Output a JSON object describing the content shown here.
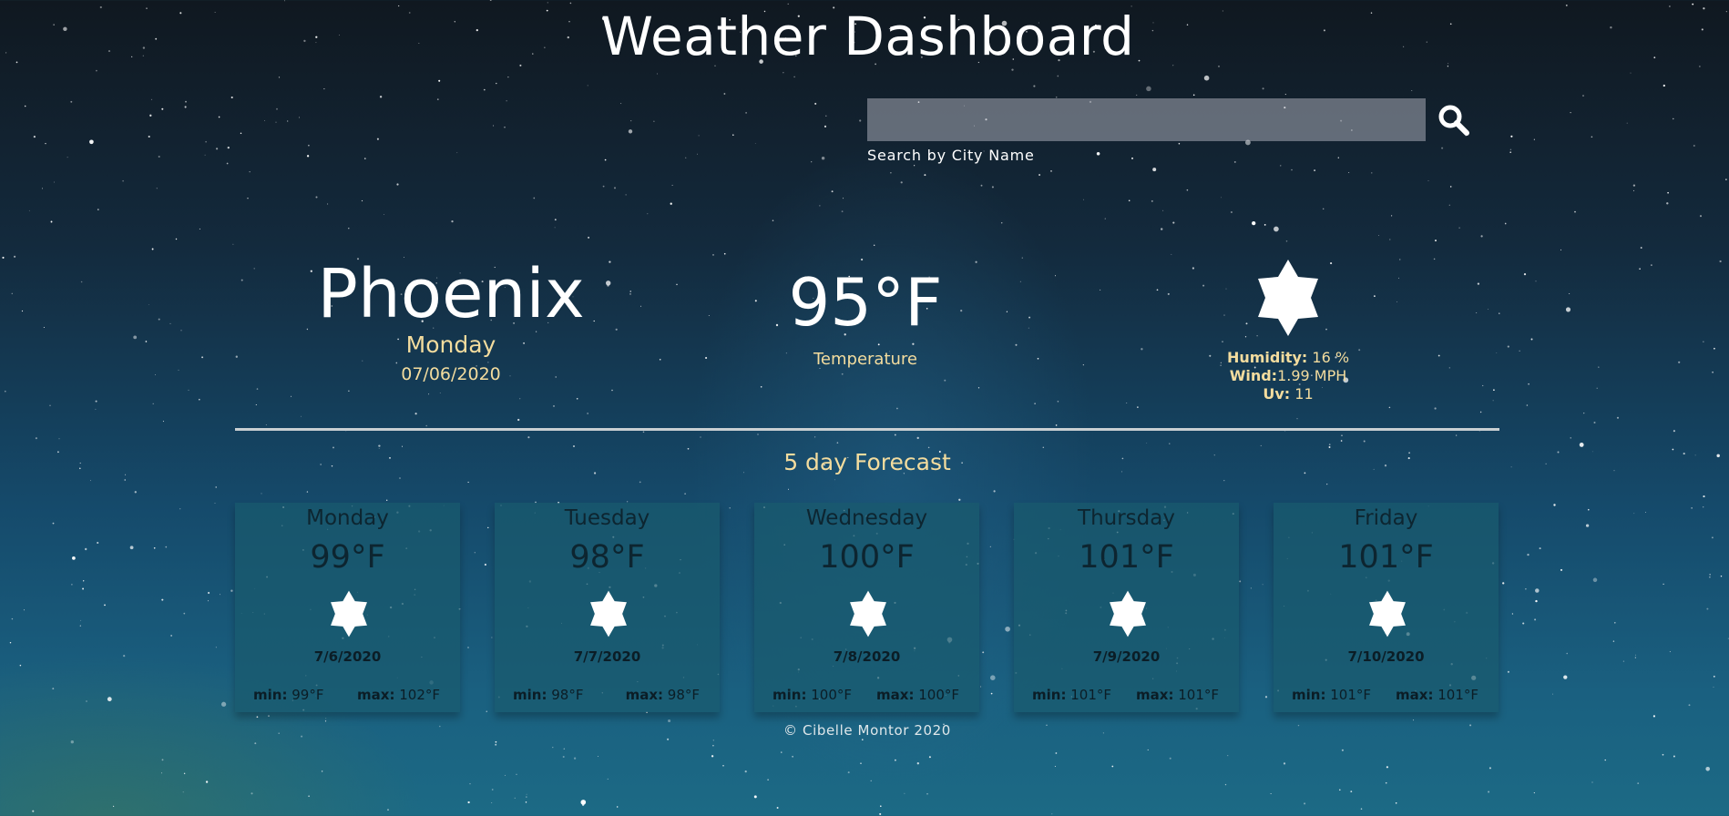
{
  "header": {
    "title": "Weather Dashboard"
  },
  "search": {
    "value": "",
    "placeholder": "",
    "label": "Search by City Name",
    "button_icon": "search-icon"
  },
  "current": {
    "city": "Phoenix",
    "day": "Monday",
    "date": "07/06/2020",
    "temperature": "95°F",
    "temperature_label": "Temperature",
    "icon": "sun-icon",
    "humidity_label": "Humidity:",
    "humidity_value": "16 %",
    "wind_label": "Wind:",
    "wind_value": "1.99 MPH",
    "uv_label": "Uv:",
    "uv_value": "11"
  },
  "forecast": {
    "title": "5 day Forecast",
    "min_label": "min:",
    "max_label": "max:",
    "days": [
      {
        "day": "Monday",
        "temp": "99°F",
        "date": "7/6/2020",
        "min": "99°F",
        "max": "102°F",
        "icon": "sun-icon"
      },
      {
        "day": "Tuesday",
        "temp": "98°F",
        "date": "7/7/2020",
        "min": "98°F",
        "max": "98°F",
        "icon": "sun-icon"
      },
      {
        "day": "Wednesday",
        "temp": "100°F",
        "date": "7/8/2020",
        "min": "100°F",
        "max": "100°F",
        "icon": "sun-icon"
      },
      {
        "day": "Thursday",
        "temp": "101°F",
        "date": "7/9/2020",
        "min": "101°F",
        "max": "101°F",
        "icon": "sun-icon"
      },
      {
        "day": "Friday",
        "temp": "101°F",
        "date": "7/10/2020",
        "min": "101°F",
        "max": "101°F",
        "icon": "sun-icon"
      }
    ]
  },
  "footer": {
    "text": "© Cibelle Montor 2020"
  },
  "colors": {
    "accent_text": "#f3dc9e",
    "card_background": "#195a6e",
    "divider": "#c9cfd2"
  }
}
